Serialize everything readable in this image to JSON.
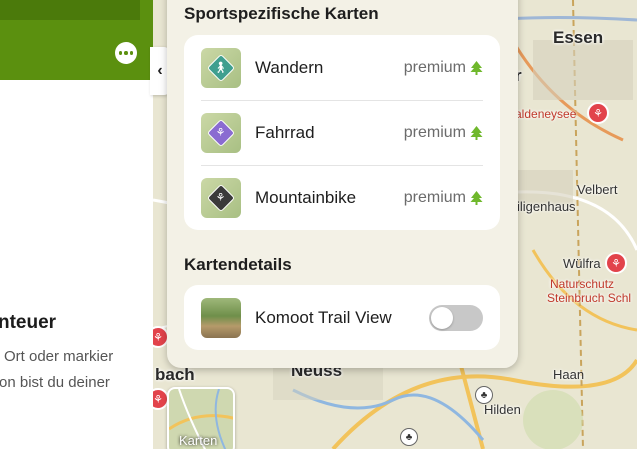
{
  "left_panel": {
    "title": "nteuer",
    "text_line_1": "Ort oder markier",
    "text_line_2": "on bist du deiner"
  },
  "layers": {
    "sport_title": "Sportspezifische Karten",
    "sport_items": [
      {
        "label": "Wandern",
        "badge": "premium",
        "icon": "hiking-icon"
      },
      {
        "label": "Fahrrad",
        "badge": "premium",
        "icon": "bicycle-icon"
      },
      {
        "label": "Mountainbike",
        "badge": "premium",
        "icon": "mountainbike-icon"
      }
    ],
    "details_title": "Kartendetails",
    "details_items": [
      {
        "label": "Komoot Trail View",
        "toggle_on": false
      }
    ],
    "map_style_label": "Karten"
  },
  "map": {
    "labels": [
      "Essen",
      "aldeneysee",
      "Velbert",
      "iligenhaus",
      "Wülfra",
      "Naturschutz",
      "Steinbruch Schl",
      "bach",
      "Neuss",
      "Haan",
      "Hilden",
      "r"
    ]
  },
  "colors": {
    "brand_green": "#5b900f",
    "premium_tree": "#6fb82c",
    "toggle_off": "#c8c8c8"
  }
}
